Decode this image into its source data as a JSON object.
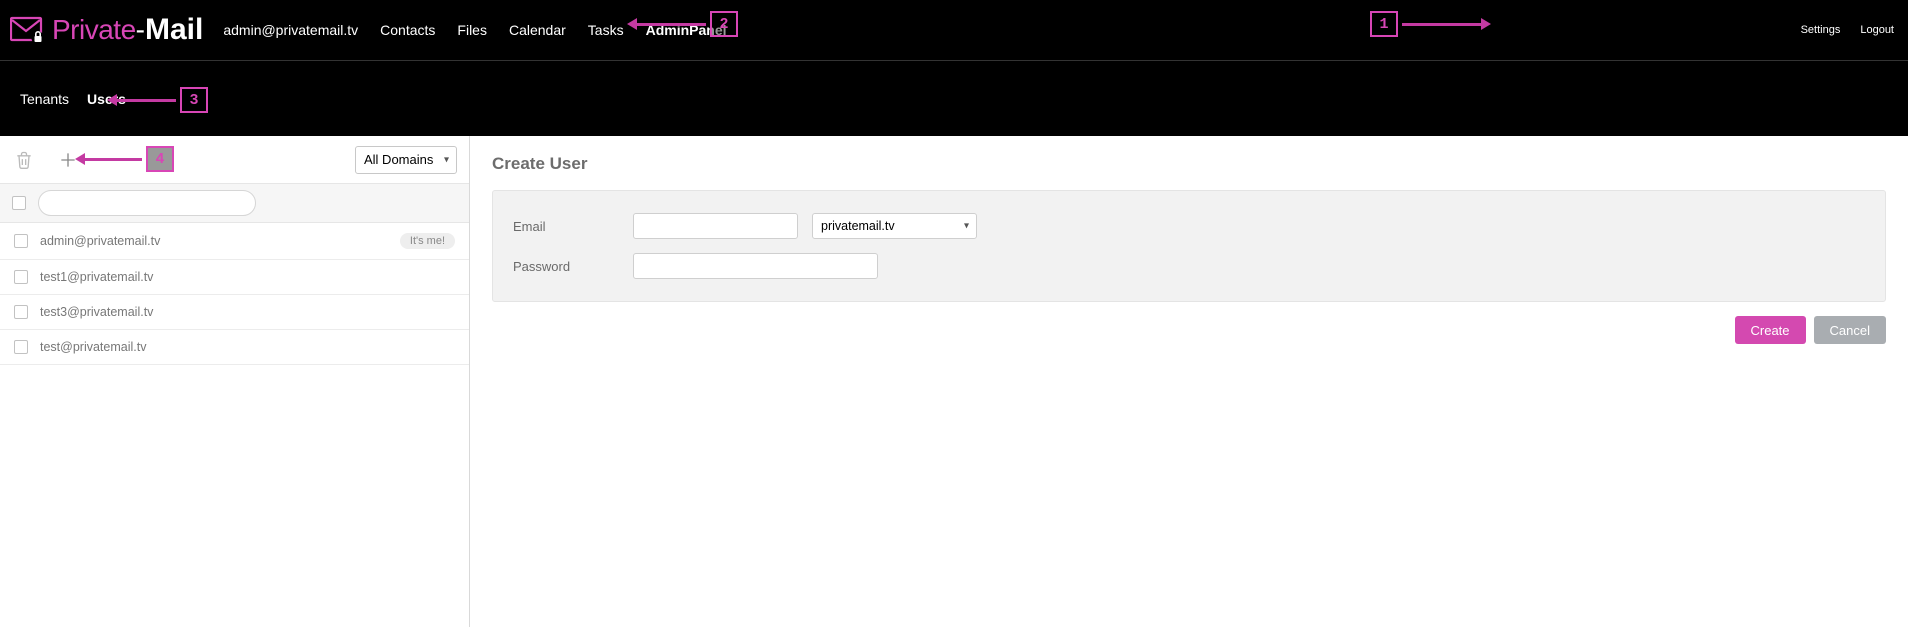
{
  "brand": {
    "private": "Private",
    "dash": "-",
    "mail": "Mail"
  },
  "header": {
    "user_email": "admin@privatemail.tv",
    "nav": {
      "contacts": "Contacts",
      "files": "Files",
      "calendar": "Calendar",
      "tasks": "Tasks",
      "admin_panel": "AdminPanel"
    },
    "right": {
      "settings": "Settings",
      "logout": "Logout"
    }
  },
  "subnav": {
    "tenants": "Tenants",
    "users": "Users"
  },
  "sidebar": {
    "domain_filter": "All Domains",
    "search_placeholder": "",
    "users": [
      {
        "email": "admin@privatemail.tv",
        "badge": "It's me!"
      },
      {
        "email": "test1@privatemail.tv"
      },
      {
        "email": "test3@privatemail.tv"
      },
      {
        "email": "test@privatemail.tv"
      }
    ]
  },
  "form": {
    "title": "Create User",
    "email_label": "Email",
    "email_value": "",
    "domain_value": "privatemail.tv",
    "password_label": "Password",
    "password_value": "",
    "create": "Create",
    "cancel": "Cancel"
  },
  "annotations": {
    "n1": "1",
    "n2": "2",
    "n3": "3",
    "n4": "4"
  },
  "colors": {
    "accent": "#d846b6"
  }
}
